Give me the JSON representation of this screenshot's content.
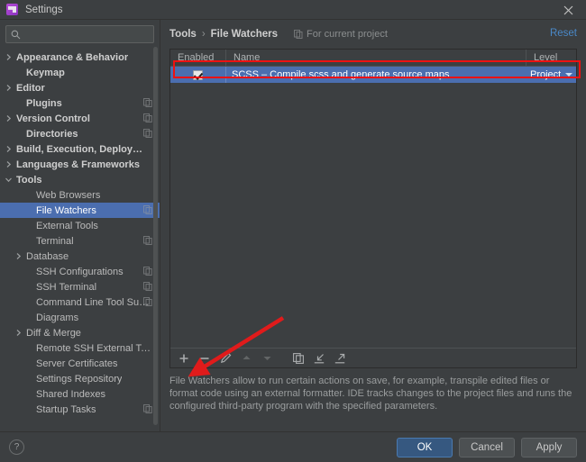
{
  "window": {
    "title": "Settings",
    "app_icon": "phpstorm-icon",
    "close_icon": "close-icon"
  },
  "sidebar": {
    "search": {
      "value": "",
      "placeholder": ""
    },
    "items": [
      {
        "label": "Appearance & Behavior",
        "indent": 0,
        "arrow": "right",
        "bold": true,
        "cfg": false,
        "selected": false
      },
      {
        "label": "Keymap",
        "indent": 1,
        "arrow": "none",
        "bold": true,
        "cfg": false,
        "selected": false
      },
      {
        "label": "Editor",
        "indent": 0,
        "arrow": "right",
        "bold": true,
        "cfg": false,
        "selected": false
      },
      {
        "label": "Plugins",
        "indent": 1,
        "arrow": "none",
        "bold": true,
        "cfg": true,
        "selected": false
      },
      {
        "label": "Version Control",
        "indent": 0,
        "arrow": "right",
        "bold": true,
        "cfg": true,
        "selected": false
      },
      {
        "label": "Directories",
        "indent": 1,
        "arrow": "none",
        "bold": true,
        "cfg": true,
        "selected": false
      },
      {
        "label": "Build, Execution, Deployment",
        "indent": 0,
        "arrow": "right",
        "bold": true,
        "cfg": false,
        "selected": false
      },
      {
        "label": "Languages & Frameworks",
        "indent": 0,
        "arrow": "right",
        "bold": true,
        "cfg": false,
        "selected": false
      },
      {
        "label": "Tools",
        "indent": 0,
        "arrow": "down",
        "bold": true,
        "cfg": false,
        "selected": false
      },
      {
        "label": "Web Browsers",
        "indent": 2,
        "arrow": "none",
        "bold": false,
        "cfg": false,
        "selected": false
      },
      {
        "label": "File Watchers",
        "indent": 2,
        "arrow": "none",
        "bold": false,
        "cfg": true,
        "selected": true
      },
      {
        "label": "External Tools",
        "indent": 2,
        "arrow": "none",
        "bold": false,
        "cfg": false,
        "selected": false
      },
      {
        "label": "Terminal",
        "indent": 2,
        "arrow": "none",
        "bold": false,
        "cfg": true,
        "selected": false
      },
      {
        "label": "Database",
        "indent": 1,
        "arrow": "right",
        "bold": false,
        "cfg": false,
        "selected": false
      },
      {
        "label": "SSH Configurations",
        "indent": 2,
        "arrow": "none",
        "bold": false,
        "cfg": true,
        "selected": false
      },
      {
        "label": "SSH Terminal",
        "indent": 2,
        "arrow": "none",
        "bold": false,
        "cfg": true,
        "selected": false
      },
      {
        "label": "Command Line Tool Support",
        "indent": 2,
        "arrow": "none",
        "bold": false,
        "cfg": true,
        "selected": false
      },
      {
        "label": "Diagrams",
        "indent": 2,
        "arrow": "none",
        "bold": false,
        "cfg": false,
        "selected": false
      },
      {
        "label": "Diff & Merge",
        "indent": 1,
        "arrow": "right",
        "bold": false,
        "cfg": false,
        "selected": false
      },
      {
        "label": "Remote SSH External Tools",
        "indent": 2,
        "arrow": "none",
        "bold": false,
        "cfg": false,
        "selected": false
      },
      {
        "label": "Server Certificates",
        "indent": 2,
        "arrow": "none",
        "bold": false,
        "cfg": false,
        "selected": false
      },
      {
        "label": "Settings Repository",
        "indent": 2,
        "arrow": "none",
        "bold": false,
        "cfg": false,
        "selected": false
      },
      {
        "label": "Shared Indexes",
        "indent": 2,
        "arrow": "none",
        "bold": false,
        "cfg": false,
        "selected": false
      },
      {
        "label": "Startup Tasks",
        "indent": 2,
        "arrow": "none",
        "bold": false,
        "cfg": true,
        "selected": false
      }
    ]
  },
  "main": {
    "breadcrumb": {
      "root": "Tools",
      "separator": "›",
      "leaf": "File Watchers"
    },
    "scope_label": "For current project",
    "reset_label": "Reset",
    "table": {
      "columns": [
        "Enabled",
        "Name",
        "Level"
      ],
      "rows": [
        {
          "enabled": true,
          "name": "SCSS – Compile scss and generate source maps",
          "level": "Project",
          "selected": true
        }
      ]
    },
    "toolbar": [
      {
        "name": "add-button",
        "glyph": "plus",
        "enabled": true
      },
      {
        "name": "remove-button",
        "glyph": "minus",
        "enabled": true
      },
      {
        "name": "edit-button",
        "glyph": "pencil",
        "enabled": true
      },
      {
        "name": "move-up-button",
        "glyph": "arrow-up",
        "enabled": false
      },
      {
        "name": "move-down-button",
        "glyph": "arrow-down",
        "enabled": false
      },
      {
        "name": "copy-button",
        "glyph": "copy",
        "enabled": true
      },
      {
        "name": "import-button",
        "glyph": "import",
        "enabled": true
      },
      {
        "name": "export-button",
        "glyph": "export",
        "enabled": true
      }
    ],
    "description": "File Watchers allow to run certain actions on save, for example, transpile edited files or format code using an external formatter. IDE tracks changes to the project files and runs the configured third-party program with the specified parameters."
  },
  "footer": {
    "help_label": "?",
    "ok_label": "OK",
    "cancel_label": "Cancel",
    "apply_label": "Apply"
  },
  "annotations": {
    "highlight_color": "#ee1111",
    "arrow_color": "#e01b1b",
    "arrow_target": "edit-button"
  },
  "colors": {
    "background": "#3c3f41",
    "selection": "#4b6eaf",
    "link": "#4a88c7",
    "primary_button": "#365880"
  }
}
